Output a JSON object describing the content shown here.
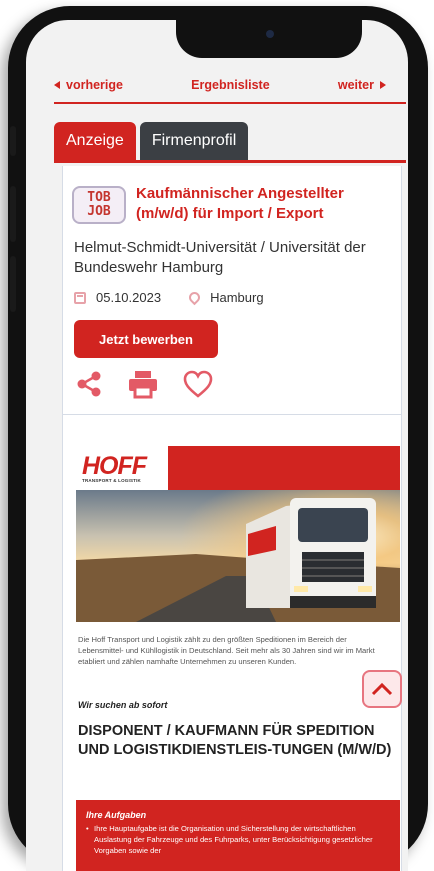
{
  "nav": {
    "prev_label": "vorherige",
    "list_label": "Ergebnisliste",
    "next_label": "weiter"
  },
  "tabs": [
    {
      "label": "Anzeige",
      "active": true
    },
    {
      "label": "Firmenprofil",
      "active": false
    }
  ],
  "job": {
    "logo_line1": "TOB",
    "logo_line2": "JOB",
    "title": "Kaufmännischer Angestellter (m/w/d) für Import / Export",
    "company": "Helmut-Schmidt-Universität / Universität der Bundeswehr Hamburg",
    "date": "05.10.2023",
    "location": "Hamburg",
    "apply_label": "Jetzt bewerben"
  },
  "actions": {
    "share_icon": "share-icon",
    "print_icon": "printer-icon",
    "favorite_icon": "heart-icon"
  },
  "ad": {
    "brand": "HOFF",
    "brand_sub": "TRANSPORT & LOGISTIK",
    "intro": "Die Hoff Transport und Logistik zählt zu den größten Speditionen im Bereich der Lebensmittel- und Kühllogistik in Deutschland. Seit mehr als 30 Jahren sind wir im Markt etabliert und zählen namhafte Unternehmen zu unseren Kunden.",
    "seek": "Wir suchen ab sofort",
    "headline": "DISPONENT / KAUFMANN FÜR SPEDITION UND LOGISTIKDIENSTLEIS-TUNGEN (M/W/D)",
    "tasks_title": "Ihre Aufgaben",
    "tasks_text": "Ihre Hauptaufgabe ist die Organisation und Sicherstellung der wirtschaftlichen Auslastung der Fahrzeuge und des Fuhrparks, unter Berücksichtigung gesetzlicher Vorgaben sowie der"
  },
  "colors": {
    "accent": "#d12420",
    "tab_inactive": "#3b3f44"
  }
}
